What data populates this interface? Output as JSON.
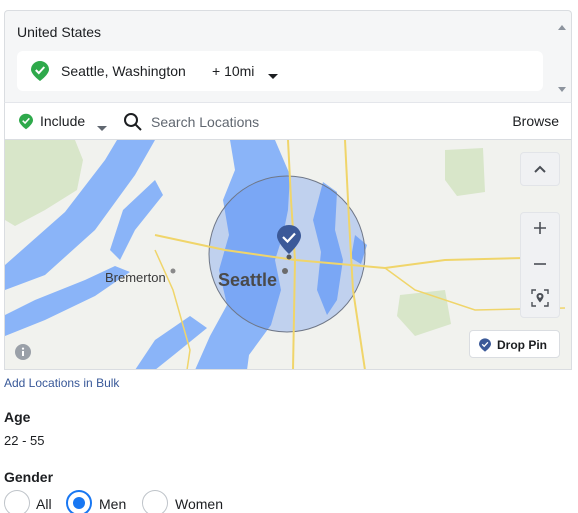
{
  "location": {
    "country": "United States",
    "selected": {
      "label": "Seattle, Washington",
      "radius": "+ 10mi"
    }
  },
  "include_bar": {
    "mode": "Include",
    "search_placeholder": "Search Locations",
    "browse": "Browse"
  },
  "map": {
    "city_primary": "Seattle",
    "city_secondary": "Bremerton",
    "drop_pin": "Drop Pin",
    "colors": {
      "water": "#8ab4f8",
      "land": "#f1f2ee",
      "radius_fill": "#5b8def",
      "accent": "#1877f2",
      "pin": "#3b5998"
    }
  },
  "bulk_link": "Add Locations in Bulk",
  "age": {
    "title": "Age",
    "value": "22 - 55"
  },
  "gender": {
    "title": "Gender",
    "options": [
      {
        "label": "All",
        "selected": false
      },
      {
        "label": "Men",
        "selected": true
      },
      {
        "label": "Women",
        "selected": false
      }
    ]
  },
  "icons": [
    "check-pin-icon",
    "caret-down-icon",
    "search-icon",
    "chevron-up-icon",
    "plus-icon",
    "minus-icon",
    "locate-icon",
    "info-icon"
  ]
}
